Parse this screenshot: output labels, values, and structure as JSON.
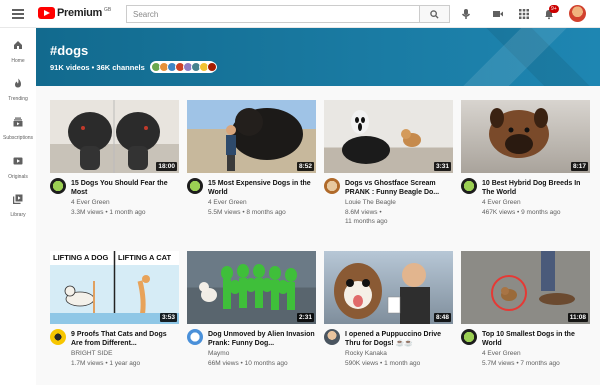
{
  "header": {
    "logo_text": "Premium",
    "logo_region": "GB",
    "search_placeholder": "Search",
    "notifications_badge": "9+"
  },
  "sidebar": {
    "items": [
      {
        "label": "Home",
        "icon": "home-icon"
      },
      {
        "label": "Trending",
        "icon": "flame-icon"
      },
      {
        "label": "Subscriptions",
        "icon": "subscriptions-icon"
      },
      {
        "label": "Originals",
        "icon": "originals-icon"
      },
      {
        "label": "Library",
        "icon": "library-icon"
      }
    ]
  },
  "banner": {
    "title": "#dogs",
    "stats": "91K videos • 36K channels",
    "color": "#1a7ba3"
  },
  "videos": [
    {
      "title": "15 Dogs You Should Fear the Most",
      "channel": "4 Ever Green",
      "stats": "3.3M views • 1 month ago",
      "duration": "18:00"
    },
    {
      "title": "15 Most Expensive Dogs in the World",
      "channel": "4 Ever Green",
      "stats": "5.5M views • 8 months ago",
      "duration": "8:52"
    },
    {
      "title": "Dogs vs Ghostface Scream PRANK : Funny Beagle Do...",
      "channel": "Louie The Beagle",
      "stats": "8.6M views •",
      "stats2": "11 months ago",
      "duration": "3:31"
    },
    {
      "title": "10 Best Hybrid Dog Breeds In The World",
      "channel": "4 Ever Green",
      "stats": "467K views • 9 months ago",
      "duration": "8:17"
    },
    {
      "title": "9 Proofs That Cats and Dogs Are from Different...",
      "channel": "BRIGHT SIDE",
      "stats": "1.7M views • 1 year ago",
      "duration": "3:53",
      "thumb_left": "LIFTING A DOG",
      "thumb_right": "LIFTING A CAT"
    },
    {
      "title": "Dog Unmoved by Alien Invasion Prank: Funny Dog...",
      "channel": "Maymo",
      "stats": "66M views • 10 months ago",
      "duration": "2:31"
    },
    {
      "title": "I opened a Puppuccino Drive Thru for Dogs! ☕☕",
      "channel": "Rocky Kanaka",
      "stats": "590K views • 1 month ago",
      "duration": "8:48"
    },
    {
      "title": "Top 10 Smallest Dogs in the World",
      "channel": "4 Ever Green",
      "stats": "5.7M views • 7 months ago",
      "duration": "11:08"
    }
  ]
}
